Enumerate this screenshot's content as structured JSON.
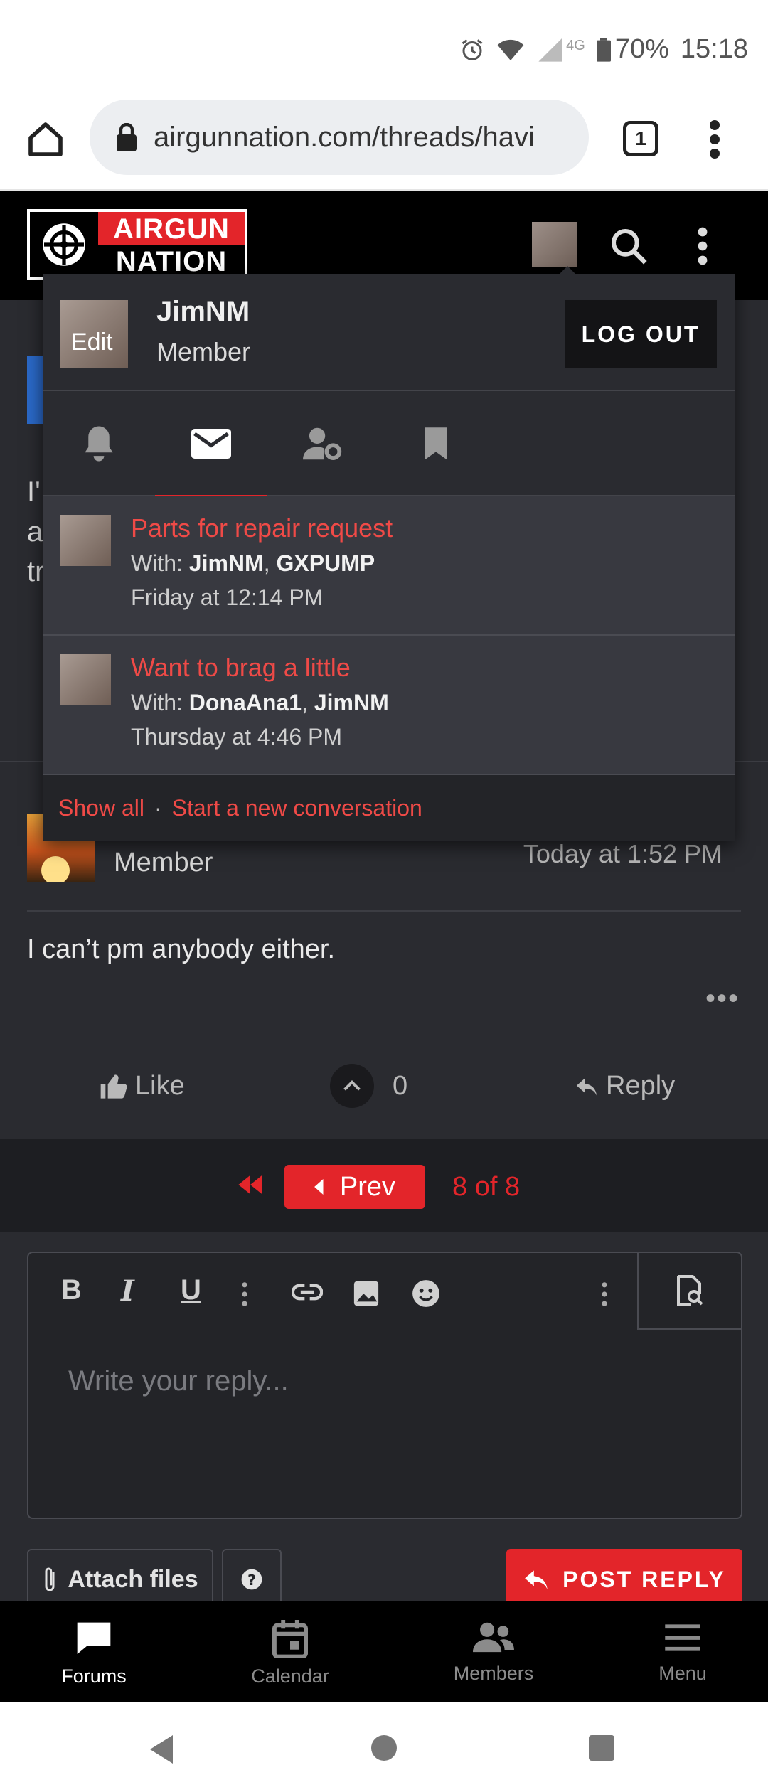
{
  "status_bar": {
    "network": "4G",
    "battery": "70%",
    "time": "15:18"
  },
  "browser": {
    "url": "airgunnation.com/threads/havi",
    "tab_count": "1"
  },
  "header": {
    "logo_line1": "AIRGUN",
    "logo_line2": "NATION"
  },
  "page": {
    "fragment1": "I'",
    "fragment2": "a",
    "fragment3": "tr",
    "post": {
      "role": "Member",
      "time": "Today at 1:52 PM",
      "body": "I can’t pm anybody either.",
      "more": "•••",
      "like_label": "Like",
      "vote_count": "0",
      "reply_label": "Reply"
    },
    "pager": {
      "prev_label": "Prev",
      "page_count": "8 of 8"
    },
    "editor": {
      "placeholder": "Write your reply...",
      "bold": "B",
      "italic": "I",
      "underline": "U"
    },
    "attach_label": "Attach files",
    "post_reply_label": "POST REPLY"
  },
  "account_menu": {
    "name": "JimNM",
    "role": "Member",
    "edit_label": "Edit",
    "logout_label": "LOG OUT",
    "conversations": [
      {
        "title": "Parts for repair request",
        "with_label": "With: ",
        "p1": "JimNM",
        "sep": ", ",
        "p2": "GXPUMP",
        "time": "Friday at 12:14 PM"
      },
      {
        "title": "Want to brag a little",
        "with_label": "With: ",
        "p1": "DonaAna1",
        "sep": ", ",
        "p2": "JimNM",
        "time": "Thursday at 4:46 PM"
      }
    ],
    "show_all": "Show all",
    "separator": "·",
    "start_new": "Start a new conversation"
  },
  "bottom_nav": {
    "forums": "Forums",
    "calendar": "Calendar",
    "members": "Members",
    "menu": "Menu"
  },
  "colors": {
    "accent": "#e3252a",
    "background": "#2a2b30",
    "menu": "#313238"
  }
}
